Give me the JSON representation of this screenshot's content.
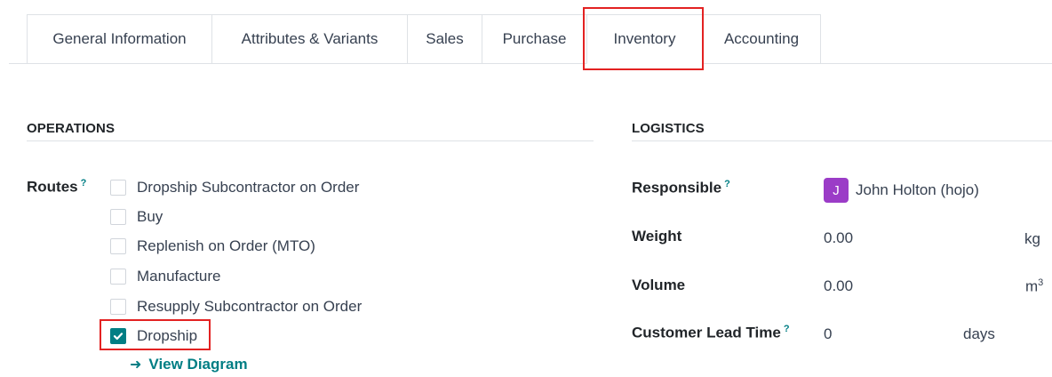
{
  "tabs": [
    {
      "label": "General Information"
    },
    {
      "label": "Attributes & Variants"
    },
    {
      "label": "Sales"
    },
    {
      "label": "Purchase"
    },
    {
      "label": "Inventory"
    },
    {
      "label": "Accounting"
    }
  ],
  "operations": {
    "title": "OPERATIONS",
    "routes_label": "Routes",
    "help_mark": "?",
    "routes": [
      {
        "label": "Dropship Subcontractor on Order",
        "checked": false
      },
      {
        "label": "Buy",
        "checked": false
      },
      {
        "label": "Replenish on Order (MTO)",
        "checked": false
      },
      {
        "label": "Manufacture",
        "checked": false
      },
      {
        "label": "Resupply Subcontractor on Order",
        "checked": false
      },
      {
        "label": "Dropship",
        "checked": true
      }
    ],
    "view_diagram": "View Diagram"
  },
  "logistics": {
    "title": "LOGISTICS",
    "responsible_label": "Responsible",
    "responsible_initial": "J",
    "responsible_name": "John Holton (hojo)",
    "weight_label": "Weight",
    "weight_value": "0.00",
    "weight_unit": "kg",
    "volume_label": "Volume",
    "volume_value": "0.00",
    "volume_unit": "m",
    "volume_unit_sup": "3",
    "lead_time_label": "Customer Lead Time",
    "lead_time_value": "0",
    "lead_time_unit": "days",
    "help_mark": "?"
  },
  "colors": {
    "accent": "#017e84",
    "highlight": "#e32222",
    "avatar": "#9b3cc7"
  }
}
